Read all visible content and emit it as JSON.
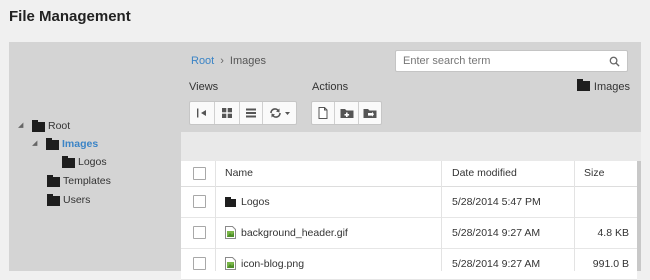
{
  "app": {
    "title": "File Management"
  },
  "tree": {
    "nodes": [
      {
        "label": "Root",
        "expander": "◢"
      },
      {
        "label": "Images",
        "expander": "◢"
      },
      {
        "label": "Logos",
        "expander": ""
      },
      {
        "label": "Templates",
        "expander": ""
      },
      {
        "label": "Users",
        "expander": ""
      }
    ]
  },
  "breadcrumb": {
    "root": "Root",
    "separator": "›",
    "current": "Images"
  },
  "search": {
    "placeholder": "Enter search term",
    "icon": "search-icon"
  },
  "toolbar": {
    "views_label": "Views",
    "actions_label": "Actions",
    "current_folder": "Images",
    "views_buttons": [
      "collapse-pane-icon",
      "thumbnails-view-icon",
      "list-view-icon",
      "refresh-icon"
    ],
    "actions_buttons": [
      "new-file-icon",
      "new-folder-icon",
      "move-folder-icon"
    ]
  },
  "grid": {
    "columns": {
      "name": "Name",
      "date": "Date modified",
      "size": "Size"
    },
    "rows": [
      {
        "name": "Logos",
        "date": "5/28/2014 5:47 PM",
        "size": "",
        "type": "folder"
      },
      {
        "name": "background_header.gif",
        "date": "5/28/2014 9:27 AM",
        "size": "4.8 KB",
        "type": "image"
      },
      {
        "name": "icon-blog.png",
        "date": "5/28/2014 9:27 AM",
        "size": "991.0 B",
        "type": "image"
      }
    ]
  },
  "colors": {
    "accent": "#3b84c6",
    "panel": "#d4d4d4",
    "folder": "#1e1e1e"
  }
}
